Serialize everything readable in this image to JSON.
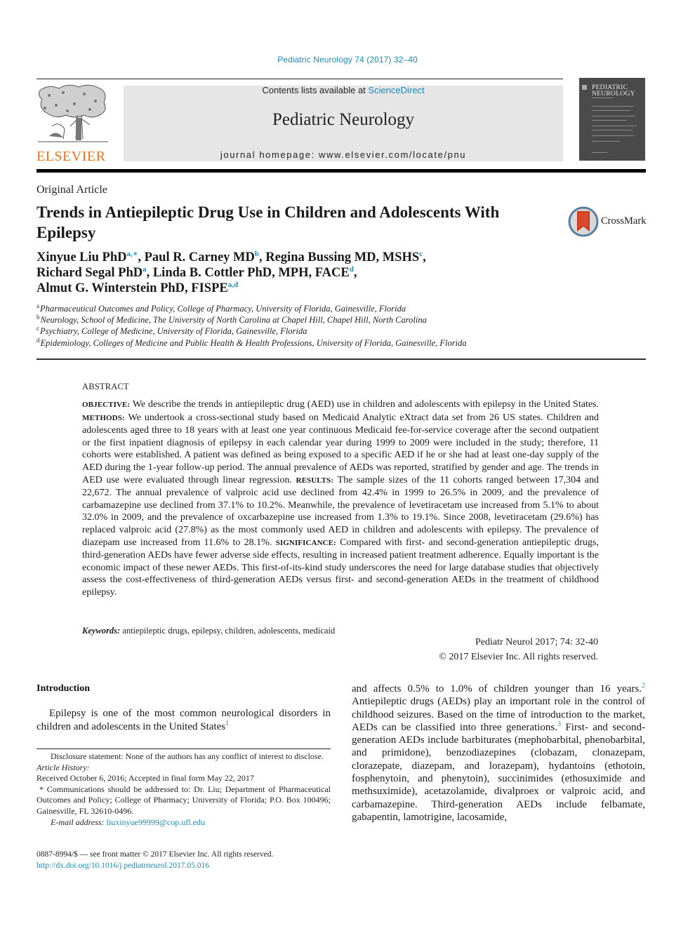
{
  "header": {
    "journal_reference": "Pediatric Neurology 74 (2017) 32–40",
    "contents_prefix": "Contents lists available at ",
    "contents_link": "ScienceDirect",
    "journal_name": "Pediatric Neurology",
    "homepage": "journal homepage: www.elsevier.com/locate/pnu",
    "publisher_wordmark": "ELSEVIER",
    "cover_title_line1": "PEDIATRIC",
    "cover_title_line2": "NEUROLOGY",
    "brand_color": "#e8731a",
    "link_color": "#1d8bb8"
  },
  "article": {
    "type": "Original Article",
    "title": "Trends in Antiepileptic Drug Use in Children and Adolescents With Epilepsy",
    "crossmark_label": "CrossMark",
    "authors": [
      {
        "name": "Xinyue Liu PhD",
        "sup": "a,∗",
        "sep": ", "
      },
      {
        "name": "Paul R. Carney MD",
        "sup": "b",
        "sep": ", "
      },
      {
        "name": "Regina Bussing MD, MSHS",
        "sup": "c",
        "sep": ","
      },
      {
        "name": "Richard Segal PhD",
        "sup": "a",
        "sep": ", "
      },
      {
        "name": "Linda B. Cottler PhD, MPH, FACE",
        "sup": "d",
        "sep": ","
      },
      {
        "name": "Almut G. Winterstein PhD, FISPE",
        "sup": "a,d",
        "sep": ""
      }
    ],
    "affiliations": [
      {
        "key": "a",
        "text": "Pharmaceutical Outcomes and Policy, College of Pharmacy, University of Florida, Gainesville, Florida"
      },
      {
        "key": "b",
        "text": "Neurology, School of Medicine, The University of North Carolina at Chapel Hill, Chapel Hill, North Carolina"
      },
      {
        "key": "c",
        "text": "Psychiatry, College of Medicine, University of Florida, Gainesville, Florida"
      },
      {
        "key": "d",
        "text": "Epidemiology, Colleges of Medicine and Public Health & Health Professions, University of Florida, Gainesville, Florida"
      }
    ]
  },
  "abstract": {
    "heading": "ABSTRACT",
    "objective_label": "OBJECTIVE:",
    "objective": " We describe the trends in antiepileptic drug (AED) use in children and adolescents with epilepsy in the United States. ",
    "methods_label": "METHODS:",
    "methods": " We undertook a cross-sectional study based on Medicaid Analytic eXtract data set from 26 US states. Children and adolescents aged three to 18 years with at least one year continuous Medicaid fee-for-service coverage after the second outpatient or the first inpatient diagnosis of epilepsy in each calendar year during 1999 to 2009 were included in the study; therefore, 11 cohorts were established. A patient was defined as being exposed to a specific AED if he or she had at least one-day supply of the AED during the 1-year follow-up period. The annual prevalence of AEDs was reported, stratified by gender and age. The trends in AED use were evaluated through linear regression. ",
    "results_label": "RESULTS:",
    "results": " The sample sizes of the 11 cohorts ranged between 17,304 and 22,672. The annual prevalence of valproic acid use declined from 42.4% in 1999 to 26.5% in 2009, and the prevalence of carbamazepine use declined from 37.1% to 10.2%. Meanwhile, the prevalence of levetiracetam use increased from 5.1% to about 32.0% in 2009, and the prevalence of oxcarbazepine use increased from 1.3% to 19.1%. Since 2008, levetiracetam (29.6%) has replaced valproic acid (27.8%) as the most commonly used AED in children and adolescents with epilepsy. The prevalence of diazepam use increased from 11.6% to 28.1%. ",
    "significance_label": "SIGNIFICANCE:",
    "significance": " Compared with first- and second-generation antiepileptic drugs, third-generation AEDs have fewer adverse side effects, resulting in increased patient treatment adherence. Equally important is the economic impact of these newer AEDs. This first-of-its-kind study underscores the need for large database studies that objectively assess the cost-effectiveness of third-generation AEDs versus first- and second-generation AEDs in the treatment of childhood epilepsy.",
    "keywords_label": "Keywords:",
    "keywords": " antiepileptic drugs, epilepsy, children, adolescents, medicaid",
    "citation": "Pediatr Neurol 2017; 74: 32-40",
    "copyright": "© 2017 Elsevier Inc. All rights reserved."
  },
  "body": {
    "intro_heading": "Introduction",
    "left_para": "Epilepsy is one of the most common neurological disorders in children and adolescents in the United States",
    "left_ref": "1",
    "right_part1": "and affects 0.5% to 1.0% of children younger than 16 years.",
    "right_ref1": "2",
    "right_part2": " Antiepileptic drugs (AEDs) play an important role in the control of childhood seizures. Based on the time of introduction to the market, AEDs can be classified into three generations.",
    "right_ref2": "3",
    "right_part3": " First- and second-generation AEDs include barbiturates (mephobarbital, phenobarbital, and primidone), benzodiazepines (clobazam, clonazepam, clorazepate, diazepam, and lorazepam), hydantoins (ethotoin, fosphenytoin, and phenytoin), succinimides (ethosuximide and methsuximide), acetazolamide, divalproex or valproic acid, and carbamazepine. Third-generation AEDs include felbamate, gabapentin, lamotrigine, lacosamide,"
  },
  "footnotes": {
    "disclosure": "Disclosure statement: None of the authors has any conflict of interest to disclose.",
    "history_label": "Article History:",
    "history": "Received October 6, 2016; Accepted in final form May 22, 2017",
    "correspondence": "* Communications should be addressed to: Dr. Liu; Department of Pharmaceutical Outcomes and Policy; College of Pharmacy; University of Florida; P.O. Box 100496; Gainesville, FL 32610-0496.",
    "email_label": "E-mail address: ",
    "email": "liuxinyue99999@cop.ufl.edu"
  },
  "bottom": {
    "issn_line": "0887-8994/$ — see front matter © 2017 Elsevier Inc. All rights reserved.",
    "doi": "http://dx.doi.org/10.1016/j.pediatrneurol.2017.05.016"
  }
}
